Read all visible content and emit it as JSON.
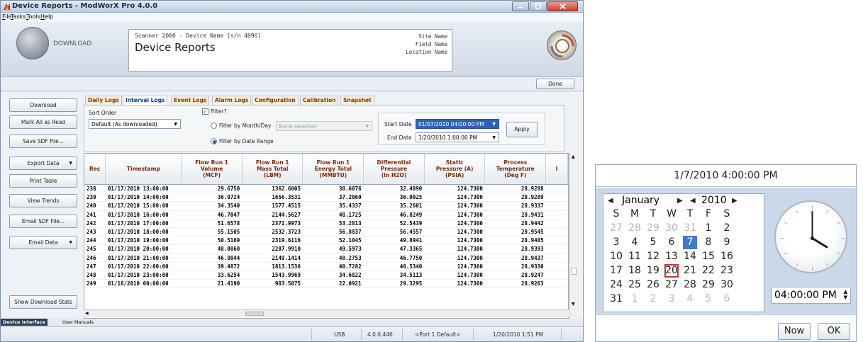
{
  "window": {
    "title": "Device Reports - ModWorX Pro 4.0.0",
    "menu": [
      {
        "label": "File",
        "key": "F",
        "rest": "ile"
      },
      {
        "label": "Tasks",
        "key": "T",
        "rest": "asks"
      },
      {
        "label": "Tools",
        "key": "T",
        "rest": "ools"
      },
      {
        "label": "Help",
        "key": "H",
        "rest": "elp"
      }
    ]
  },
  "header": {
    "download_label": "DOWNLOAD",
    "scanner_line": "Scanner 2000 - Device Name [s/n 4096]",
    "page_title": "Device Reports",
    "site_name": "Site Name",
    "field_name": "Field Name",
    "location_name": "Location Name",
    "done_label": "Done"
  },
  "sidebar": {
    "buttons": [
      {
        "label": "Download",
        "dropdown": false
      },
      {
        "label": "Mark All as Read",
        "dropdown": false
      },
      {
        "label": "Save SDF File...",
        "dropdown": false
      },
      {
        "label": "Export Data",
        "dropdown": true
      },
      {
        "label": "Print Table",
        "dropdown": false
      },
      {
        "label": "View Trends",
        "dropdown": false
      },
      {
        "label": "Email SDF File...",
        "dropdown": false
      },
      {
        "label": "Email Data",
        "dropdown": true
      },
      {
        "label": "Show Download Stats",
        "dropdown": false
      }
    ]
  },
  "tabs": [
    {
      "label": "Daily Logs",
      "active": false
    },
    {
      "label": "Interval Logs",
      "active": true
    },
    {
      "label": "Event Logs",
      "active": false
    },
    {
      "label": "Alarm Logs",
      "active": false
    },
    {
      "label": "Configuration",
      "active": false
    },
    {
      "label": "Calibration",
      "active": false
    },
    {
      "label": "Snapshot",
      "active": false
    }
  ],
  "filters": {
    "sort_order_label": "Sort Order",
    "sort_order_value": "Default (As downloaded)",
    "filter_label": "Filter?",
    "filter_checked": true,
    "by_month_day_label": "Filter by Month/Day",
    "month_day_value": "None selected",
    "by_date_range_label": "Filter by Date Range",
    "start_date_label": "Start Date",
    "start_date_value": "01/07/2010 04:00:00 PM",
    "end_date_label": "End Date",
    "end_date_value": "1/20/2010 1:00:00 PM",
    "apply_label": "Apply"
  },
  "table": {
    "columns": [
      "Rec",
      "Timestamp",
      "Flow Run 1\nVolume\n(MCF)",
      "Flow Run 1\nMass Total\n(LBM)",
      "Flow Run 1\nEnergy Total\n(MMBTU)",
      "Differential\nPressure\n(In H2O)",
      "Static\nPressure (A)\n(PSIA)",
      "Process\nTemperature\n(Deg F)"
    ],
    "rows": [
      [
        "238",
        "01/17/2010 13:00:00",
        "29.6750",
        "1362.6005",
        "30.6076",
        "32.4890",
        "124.7300",
        "28.9288"
      ],
      [
        "239",
        "01/17/2010 14:00:00",
        "36.0724",
        "1656.3531",
        "37.2060",
        "36.0025",
        "124.7300",
        "28.9289"
      ],
      [
        "240",
        "01/17/2010 15:00:00",
        "34.3540",
        "1577.4515",
        "35.4337",
        "35.2601",
        "124.7300",
        "28.9337"
      ],
      [
        "241",
        "01/17/2010 16:00:00",
        "46.7047",
        "2144.5627",
        "48.1725",
        "46.8249",
        "124.7300",
        "28.9431"
      ],
      [
        "242",
        "01/17/2010 17:00:00",
        "51.6578",
        "2371.9973",
        "53.2813",
        "52.5439",
        "124.7300",
        "28.9442"
      ],
      [
        "243",
        "01/17/2010 18:00:00",
        "55.1505",
        "2532.3723",
        "56.8837",
        "56.4557",
        "124.7300",
        "28.9545"
      ],
      [
        "244",
        "01/17/2010 19:00:00",
        "50.5169",
        "2319.6116",
        "52.1045",
        "49.8941",
        "124.7300",
        "28.9485"
      ],
      [
        "245",
        "01/17/2010 20:00:00",
        "48.0860",
        "2207.9910",
        "49.5973",
        "47.3365",
        "124.7300",
        "28.9393"
      ],
      [
        "246",
        "01/17/2010 21:00:00",
        "46.8044",
        "2149.1414",
        "48.2753",
        "46.7750",
        "124.7300",
        "28.9437"
      ],
      [
        "247",
        "01/17/2010 22:00:00",
        "39.4872",
        "1813.1536",
        "40.7282",
        "40.5340",
        "124.7300",
        "28.9330"
      ],
      [
        "248",
        "01/17/2010 23:00:00",
        "33.6254",
        "1543.9969",
        "34.6822",
        "34.5113",
        "124.7300",
        "28.9247"
      ],
      [
        "249",
        "01/18/2010 00:00:00",
        "21.4190",
        "983.5075",
        "22.0921",
        "29.3295",
        "124.7300",
        "28.9263"
      ]
    ]
  },
  "bottom_tabs": [
    "Device Interface",
    "User Manuals"
  ],
  "statusbar": {
    "connection": "USB",
    "version": "4.0.0.446",
    "port": "<Port 1 Default>",
    "datetime": "1/20/2010 1:51 PM"
  },
  "picker": {
    "title": "1/7/2010 4:00:00 PM",
    "month": "January",
    "year": "2010",
    "weekdays": [
      "S",
      "M",
      "T",
      "W",
      "T",
      "F",
      "S"
    ],
    "weeks": [
      [
        {
          "d": "27",
          "dim": true
        },
        {
          "d": "28",
          "dim": true
        },
        {
          "d": "29",
          "dim": true
        },
        {
          "d": "30",
          "dim": true
        },
        {
          "d": "31",
          "dim": true
        },
        {
          "d": "1"
        },
        {
          "d": "2"
        }
      ],
      [
        {
          "d": "3"
        },
        {
          "d": "4"
        },
        {
          "d": "5"
        },
        {
          "d": "6"
        },
        {
          "d": "7",
          "selected": true
        },
        {
          "d": "8"
        },
        {
          "d": "9"
        }
      ],
      [
        {
          "d": "10"
        },
        {
          "d": "11"
        },
        {
          "d": "12"
        },
        {
          "d": "13"
        },
        {
          "d": "14"
        },
        {
          "d": "15"
        },
        {
          "d": "16"
        }
      ],
      [
        {
          "d": "17"
        },
        {
          "d": "18"
        },
        {
          "d": "19"
        },
        {
          "d": "20",
          "today": true
        },
        {
          "d": "21"
        },
        {
          "d": "22"
        },
        {
          "d": "23"
        }
      ],
      [
        {
          "d": "24"
        },
        {
          "d": "25"
        },
        {
          "d": "26"
        },
        {
          "d": "27"
        },
        {
          "d": "28"
        },
        {
          "d": "29"
        },
        {
          "d": "30"
        }
      ],
      [
        {
          "d": "31"
        },
        {
          "d": "1",
          "dim": true
        },
        {
          "d": "2",
          "dim": true
        },
        {
          "d": "3",
          "dim": true
        },
        {
          "d": "4",
          "dim": true
        },
        {
          "d": "5",
          "dim": true
        },
        {
          "d": "6",
          "dim": true
        }
      ]
    ],
    "time_value": "04:00:00 PM",
    "now_label": "Now",
    "ok_label": "OK"
  },
  "icons": {
    "app": "modworx-app-icon",
    "logo": "scanner-logo-icon",
    "clock": "analog-clock-icon"
  },
  "colors": {
    "tab_text": "#7a3a0a",
    "active_tab_text": "#0d3a80",
    "selected_day": "#3d7ad2",
    "today_outline": "#cc3333",
    "header_text": "#7a2a08"
  }
}
